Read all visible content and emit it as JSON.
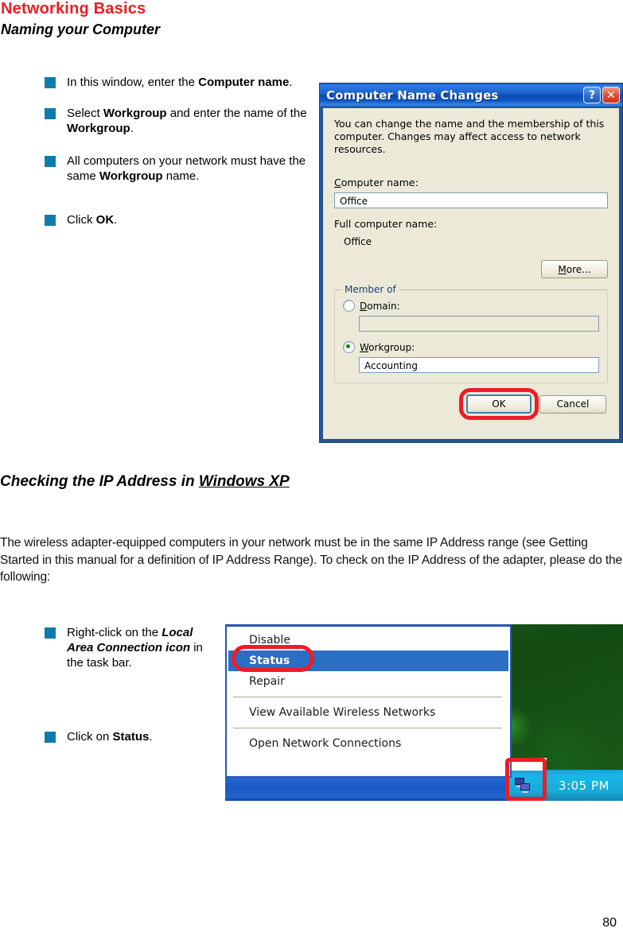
{
  "header": {
    "title": "Networking Basics",
    "subtitle": "Naming your Computer"
  },
  "bullets_top": [
    {
      "parts": [
        {
          "t": "In this window, enter the ",
          "s": "normal"
        },
        {
          "t": "Computer name",
          "s": "bold"
        },
        {
          "t": ".",
          "s": "normal"
        }
      ]
    },
    {
      "parts": [
        {
          "t": "Select ",
          "s": "normal"
        },
        {
          "t": "Workgroup",
          "s": "bold"
        },
        {
          "t": " and enter the name of the ",
          "s": "normal"
        },
        {
          "t": "Workgroup",
          "s": "bold"
        },
        {
          "t": ".",
          "s": "normal"
        }
      ]
    },
    {
      "parts": [
        {
          "t": "All computers on your network must have the same ",
          "s": "normal"
        },
        {
          "t": "Workgroup",
          "s": "bold"
        },
        {
          "t": " name.",
          "s": "normal"
        }
      ]
    },
    {
      "parts": [
        {
          "t": "Click ",
          "s": "normal"
        },
        {
          "t": "OK",
          "s": "bold"
        },
        {
          "t": ".",
          "s": "normal"
        }
      ]
    }
  ],
  "dialog": {
    "title": "Computer Name Changes",
    "help_button": "?",
    "close_button": "✕",
    "description": "You can change the name and the membership of this computer. Changes may affect access to network resources.",
    "computer_name_label_prefix": "C",
    "computer_name_label_rest": "omputer name:",
    "computer_name_value": "Office",
    "full_computer_name_label": "Full computer name:",
    "full_computer_name_value": "Office",
    "more_button_prefix": "M",
    "more_button_rest": "ore...",
    "member_of_label": "Member of",
    "domain_label_prefix": "D",
    "domain_label_rest": "omain:",
    "domain_value": "",
    "workgroup_label_prefix": "W",
    "workgroup_label_rest": "orkgroup:",
    "workgroup_value": "Accounting",
    "ok_button": "OK",
    "cancel_button": "Cancel"
  },
  "section": {
    "heading_plain": "Checking the IP Address in ",
    "heading_underlined": "Windows XP"
  },
  "body_paragraph": "The wireless adapter-equipped computers in your network must be in the same IP Address range (see Getting Started in this manual for a definition of IP Address Range). To check on the IP Address of the adapter, please do the following:",
  "bullets_bottom": [
    {
      "parts": [
        {
          "t": "Right-click on the ",
          "s": "normal"
        },
        {
          "t": "Local Area Connection icon",
          "s": "bolditalic"
        },
        {
          "t": " in the task bar.",
          "s": "normal"
        }
      ]
    },
    {
      "parts": [
        {
          "t": "Click on ",
          "s": "normal"
        },
        {
          "t": "Status",
          "s": "bold"
        },
        {
          "t": ".",
          "s": "normal"
        }
      ]
    }
  ],
  "context_menu": {
    "items": [
      {
        "label": "Disable",
        "selected": false,
        "separator_after": false
      },
      {
        "label": "Status",
        "selected": true,
        "separator_after": false
      },
      {
        "label": "Repair",
        "selected": false,
        "separator_after": true
      },
      {
        "label": "View Available Wireless Networks",
        "selected": false,
        "separator_after": true
      },
      {
        "label": "Open Network Connections",
        "selected": false,
        "separator_after": false
      }
    ],
    "taskbar_clock": "3:05 PM",
    "tray_icon_name": "network-connection-icon"
  },
  "page_number": "80",
  "colors": {
    "header_red": "#ed1c24",
    "bullet_square": "#0e7cab",
    "highlight_red": "#ee1c25",
    "menu_selection_blue": "#2a6fc4",
    "dialog_face": "#ece9d8"
  }
}
